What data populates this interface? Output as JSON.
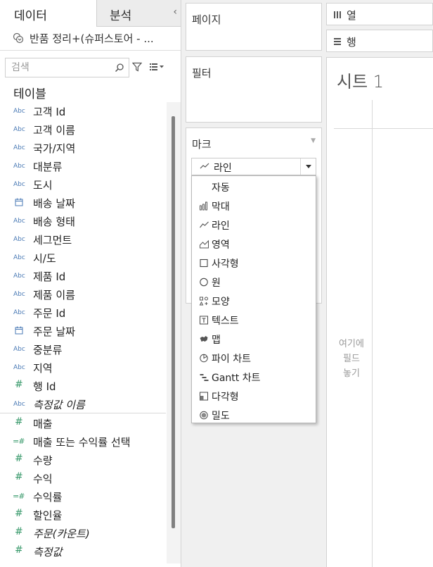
{
  "tabs": {
    "data": "데이터",
    "analysis": "분석"
  },
  "datasource": {
    "name": "반품 정리+(슈퍼스토어 - ..."
  },
  "search": {
    "placeholder": "검색"
  },
  "tables_title": "테이블",
  "fields": [
    {
      "type": "abc",
      "label": "고객 Id"
    },
    {
      "type": "abc",
      "label": "고객 이름"
    },
    {
      "type": "abc",
      "label": "국가/지역"
    },
    {
      "type": "abc",
      "label": "대분류"
    },
    {
      "type": "abc",
      "label": "도시"
    },
    {
      "type": "date",
      "label": "배송 날짜"
    },
    {
      "type": "abc",
      "label": "배송 형태"
    },
    {
      "type": "abc",
      "label": "세그먼트"
    },
    {
      "type": "abc",
      "label": "시/도"
    },
    {
      "type": "abc",
      "label": "제품 Id"
    },
    {
      "type": "abc",
      "label": "제품 이름"
    },
    {
      "type": "abc",
      "label": "주문 Id"
    },
    {
      "type": "date",
      "label": "주문 날짜"
    },
    {
      "type": "abc",
      "label": "중분류"
    },
    {
      "type": "abc",
      "label": "지역"
    },
    {
      "type": "hash",
      "label": "행 Id"
    },
    {
      "type": "abc",
      "label": "측정값 이름",
      "italic": true
    },
    {
      "type": "hash",
      "label": "매출"
    },
    {
      "type": "hash-calc",
      "label": "매출 또는 수익률 선택"
    },
    {
      "type": "hash",
      "label": "수량"
    },
    {
      "type": "hash",
      "label": "수익"
    },
    {
      "type": "hash-calc",
      "label": "수익률"
    },
    {
      "type": "hash",
      "label": "할인율"
    },
    {
      "type": "hash",
      "label": "주문(카운트)",
      "italic": true
    },
    {
      "type": "hash",
      "label": "측정값",
      "italic": true
    }
  ],
  "cards": {
    "pages": "페이지",
    "filters": "필터",
    "marks": "마크"
  },
  "marks_select": {
    "value": "라인",
    "icon": "line-icon"
  },
  "mark_types": [
    {
      "label": "자동",
      "icon": ""
    },
    {
      "label": "막대",
      "icon": "bar-icon"
    },
    {
      "label": "라인",
      "icon": "line-icon"
    },
    {
      "label": "영역",
      "icon": "area-icon"
    },
    {
      "label": "사각형",
      "icon": "square-icon"
    },
    {
      "label": "원",
      "icon": "circle-icon"
    },
    {
      "label": "모양",
      "icon": "shape-icon"
    },
    {
      "label": "텍스트",
      "icon": "text-icon"
    },
    {
      "label": "맵",
      "icon": "map-icon"
    },
    {
      "label": "파이 차트",
      "icon": "pie-icon"
    },
    {
      "label": "Gantt 차트",
      "icon": "gantt-icon"
    },
    {
      "label": "다각형",
      "icon": "polygon-icon"
    },
    {
      "label": "밀도",
      "icon": "density-icon"
    }
  ],
  "shelves": {
    "columns": "열",
    "rows": "행"
  },
  "sheet": {
    "title": "시트 1",
    "drop_hint_1": "여기에",
    "drop_hint_2": "필드",
    "drop_hint_3": "놓기"
  },
  "colors": {
    "dimension": "#4a7ab5",
    "measure": "#3a9a6c"
  }
}
